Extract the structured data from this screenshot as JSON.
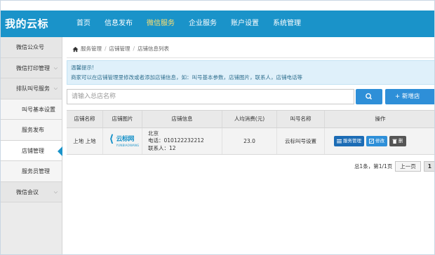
{
  "header": {
    "logo": "我的云标",
    "nav": [
      "首页",
      "信息发布",
      "微信服务",
      "企业服务",
      "账户设置",
      "系统管理"
    ],
    "active_nav": 2
  },
  "sidebar": {
    "items": [
      {
        "label": "微信公众号",
        "chevron": ""
      },
      {
        "label": "微信打印管理",
        "chevron": "v"
      },
      {
        "label": "排队叫号服务",
        "chevron": "v"
      },
      {
        "label": "叫号基本设置",
        "chevron": ""
      },
      {
        "label": "服务发布",
        "chevron": ""
      },
      {
        "label": "店铺管理",
        "chevron": ""
      },
      {
        "label": "服务员管理",
        "chevron": ""
      },
      {
        "label": "微信会议",
        "chevron": "v"
      }
    ]
  },
  "breadcrumb": [
    "服务管理",
    "店铺管理",
    "店铺信息列表"
  ],
  "tip": {
    "title": "温馨提示!",
    "text": "商家可以在店铺管理里修改或者添加店铺信息，如：叫号基本参数，店铺图片，联系人，店铺电话等"
  },
  "search": {
    "placeholder": "请输入总店名称"
  },
  "add_button": "+ 新增店",
  "table": {
    "headers": [
      "店铺名称",
      "店铺图片",
      "店铺信息",
      "人均消费(元)",
      "叫号名称",
      "操作"
    ],
    "rows": [
      {
        "name": "上地 上地",
        "image_text": "云标网",
        "image_en": "YUNBIAOWANG",
        "info": [
          "北京",
          "电话：010122232212",
          "联系人：12"
        ],
        "avg_spend": "23.0",
        "call_name": "云标叫号设置",
        "actions": [
          "服务管理",
          "修改",
          "删"
        ]
      }
    ]
  },
  "pager": {
    "summary": "总1条，第1/1页",
    "prev": "上一页",
    "page": "1"
  },
  "colors": {
    "topbar": "#1a93c9",
    "active_nav": "#ffe070",
    "button": "#2e8fd8",
    "tip_bg": "#dff0fa"
  }
}
